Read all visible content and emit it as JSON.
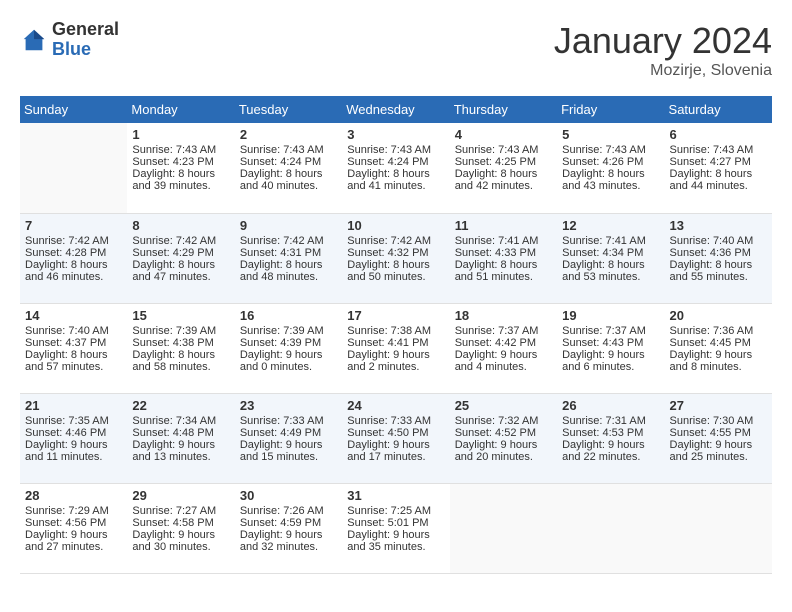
{
  "header": {
    "logo_general": "General",
    "logo_blue": "Blue",
    "month_year": "January 2024",
    "location": "Mozirje, Slovenia"
  },
  "days_of_week": [
    "Sunday",
    "Monday",
    "Tuesday",
    "Wednesday",
    "Thursday",
    "Friday",
    "Saturday"
  ],
  "weeks": [
    [
      {
        "day": "",
        "sunrise": "",
        "sunset": "",
        "daylight": ""
      },
      {
        "day": "1",
        "sunrise": "Sunrise: 7:43 AM",
        "sunset": "Sunset: 4:23 PM",
        "daylight": "Daylight: 8 hours and 39 minutes."
      },
      {
        "day": "2",
        "sunrise": "Sunrise: 7:43 AM",
        "sunset": "Sunset: 4:24 PM",
        "daylight": "Daylight: 8 hours and 40 minutes."
      },
      {
        "day": "3",
        "sunrise": "Sunrise: 7:43 AM",
        "sunset": "Sunset: 4:24 PM",
        "daylight": "Daylight: 8 hours and 41 minutes."
      },
      {
        "day": "4",
        "sunrise": "Sunrise: 7:43 AM",
        "sunset": "Sunset: 4:25 PM",
        "daylight": "Daylight: 8 hours and 42 minutes."
      },
      {
        "day": "5",
        "sunrise": "Sunrise: 7:43 AM",
        "sunset": "Sunset: 4:26 PM",
        "daylight": "Daylight: 8 hours and 43 minutes."
      },
      {
        "day": "6",
        "sunrise": "Sunrise: 7:43 AM",
        "sunset": "Sunset: 4:27 PM",
        "daylight": "Daylight: 8 hours and 44 minutes."
      }
    ],
    [
      {
        "day": "7",
        "sunrise": "Sunrise: 7:42 AM",
        "sunset": "Sunset: 4:28 PM",
        "daylight": "Daylight: 8 hours and 46 minutes."
      },
      {
        "day": "8",
        "sunrise": "Sunrise: 7:42 AM",
        "sunset": "Sunset: 4:29 PM",
        "daylight": "Daylight: 8 hours and 47 minutes."
      },
      {
        "day": "9",
        "sunrise": "Sunrise: 7:42 AM",
        "sunset": "Sunset: 4:31 PM",
        "daylight": "Daylight: 8 hours and 48 minutes."
      },
      {
        "day": "10",
        "sunrise": "Sunrise: 7:42 AM",
        "sunset": "Sunset: 4:32 PM",
        "daylight": "Daylight: 8 hours and 50 minutes."
      },
      {
        "day": "11",
        "sunrise": "Sunrise: 7:41 AM",
        "sunset": "Sunset: 4:33 PM",
        "daylight": "Daylight: 8 hours and 51 minutes."
      },
      {
        "day": "12",
        "sunrise": "Sunrise: 7:41 AM",
        "sunset": "Sunset: 4:34 PM",
        "daylight": "Daylight: 8 hours and 53 minutes."
      },
      {
        "day": "13",
        "sunrise": "Sunrise: 7:40 AM",
        "sunset": "Sunset: 4:36 PM",
        "daylight": "Daylight: 8 hours and 55 minutes."
      }
    ],
    [
      {
        "day": "14",
        "sunrise": "Sunrise: 7:40 AM",
        "sunset": "Sunset: 4:37 PM",
        "daylight": "Daylight: 8 hours and 57 minutes."
      },
      {
        "day": "15",
        "sunrise": "Sunrise: 7:39 AM",
        "sunset": "Sunset: 4:38 PM",
        "daylight": "Daylight: 8 hours and 58 minutes."
      },
      {
        "day": "16",
        "sunrise": "Sunrise: 7:39 AM",
        "sunset": "Sunset: 4:39 PM",
        "daylight": "Daylight: 9 hours and 0 minutes."
      },
      {
        "day": "17",
        "sunrise": "Sunrise: 7:38 AM",
        "sunset": "Sunset: 4:41 PM",
        "daylight": "Daylight: 9 hours and 2 minutes."
      },
      {
        "day": "18",
        "sunrise": "Sunrise: 7:37 AM",
        "sunset": "Sunset: 4:42 PM",
        "daylight": "Daylight: 9 hours and 4 minutes."
      },
      {
        "day": "19",
        "sunrise": "Sunrise: 7:37 AM",
        "sunset": "Sunset: 4:43 PM",
        "daylight": "Daylight: 9 hours and 6 minutes."
      },
      {
        "day": "20",
        "sunrise": "Sunrise: 7:36 AM",
        "sunset": "Sunset: 4:45 PM",
        "daylight": "Daylight: 9 hours and 8 minutes."
      }
    ],
    [
      {
        "day": "21",
        "sunrise": "Sunrise: 7:35 AM",
        "sunset": "Sunset: 4:46 PM",
        "daylight": "Daylight: 9 hours and 11 minutes."
      },
      {
        "day": "22",
        "sunrise": "Sunrise: 7:34 AM",
        "sunset": "Sunset: 4:48 PM",
        "daylight": "Daylight: 9 hours and 13 minutes."
      },
      {
        "day": "23",
        "sunrise": "Sunrise: 7:33 AM",
        "sunset": "Sunset: 4:49 PM",
        "daylight": "Daylight: 9 hours and 15 minutes."
      },
      {
        "day": "24",
        "sunrise": "Sunrise: 7:33 AM",
        "sunset": "Sunset: 4:50 PM",
        "daylight": "Daylight: 9 hours and 17 minutes."
      },
      {
        "day": "25",
        "sunrise": "Sunrise: 7:32 AM",
        "sunset": "Sunset: 4:52 PM",
        "daylight": "Daylight: 9 hours and 20 minutes."
      },
      {
        "day": "26",
        "sunrise": "Sunrise: 7:31 AM",
        "sunset": "Sunset: 4:53 PM",
        "daylight": "Daylight: 9 hours and 22 minutes."
      },
      {
        "day": "27",
        "sunrise": "Sunrise: 7:30 AM",
        "sunset": "Sunset: 4:55 PM",
        "daylight": "Daylight: 9 hours and 25 minutes."
      }
    ],
    [
      {
        "day": "28",
        "sunrise": "Sunrise: 7:29 AM",
        "sunset": "Sunset: 4:56 PM",
        "daylight": "Daylight: 9 hours and 27 minutes."
      },
      {
        "day": "29",
        "sunrise": "Sunrise: 7:27 AM",
        "sunset": "Sunset: 4:58 PM",
        "daylight": "Daylight: 9 hours and 30 minutes."
      },
      {
        "day": "30",
        "sunrise": "Sunrise: 7:26 AM",
        "sunset": "Sunset: 4:59 PM",
        "daylight": "Daylight: 9 hours and 32 minutes."
      },
      {
        "day": "31",
        "sunrise": "Sunrise: 7:25 AM",
        "sunset": "Sunset: 5:01 PM",
        "daylight": "Daylight: 9 hours and 35 minutes."
      },
      {
        "day": "",
        "sunrise": "",
        "sunset": "",
        "daylight": ""
      },
      {
        "day": "",
        "sunrise": "",
        "sunset": "",
        "daylight": ""
      },
      {
        "day": "",
        "sunrise": "",
        "sunset": "",
        "daylight": ""
      }
    ]
  ]
}
